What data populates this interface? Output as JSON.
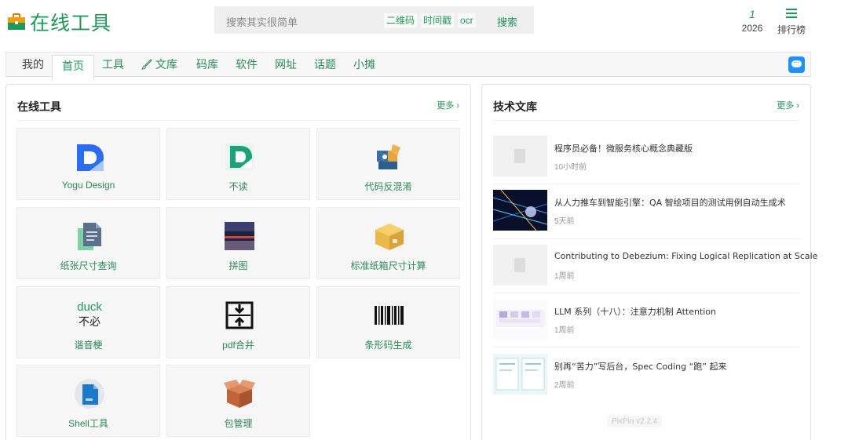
{
  "header": {
    "site_title": "在线工具",
    "search_placeholder": "搜索其实很简单",
    "chips": [
      "二维码",
      "时间戳",
      "ocr"
    ],
    "search_button": "搜索",
    "stat_number": "1",
    "stat_year": "2026",
    "rank_label": "排行榜"
  },
  "nav": {
    "items": [
      "我的",
      "首页",
      "工具",
      "文库",
      "码库",
      "软件",
      "网址",
      "话题",
      "小摊"
    ],
    "active": "首页"
  },
  "tools_panel": {
    "title": "在线工具",
    "more": "更多",
    "tools": [
      {
        "name": "Yogu Design",
        "icon": "yogu-design-icon"
      },
      {
        "name": "不读",
        "icon": "budu-icon"
      },
      {
        "name": "代码反混淆",
        "icon": "code-deobfuscate-icon"
      },
      {
        "name": "纸张尺寸查询",
        "icon": "paper-size-icon"
      },
      {
        "name": "拼图",
        "icon": "puzzle-photo-icon"
      },
      {
        "name": "标准纸箱尺寸计算",
        "icon": "carton-box-icon"
      },
      {
        "name": "谐音梗",
        "icon": "duck-pun-icon",
        "icon_text": [
          "duck",
          "不必"
        ]
      },
      {
        "name": "pdf合并",
        "icon": "pdf-merge-icon"
      },
      {
        "name": "条形码生成",
        "icon": "barcode-icon"
      },
      {
        "name": "Shell工具",
        "icon": "shell-tool-icon"
      },
      {
        "name": "包管理",
        "icon": "package-box-icon"
      }
    ]
  },
  "articles_panel": {
    "title": "技术文库",
    "more": "更多",
    "articles": [
      {
        "title": "程序员必备！微服务核心概念典藏版",
        "time": "10小时前",
        "thumb": "placeholder"
      },
      {
        "title": "从人力推车到智能引擎：QA 智绘项目的测试用例自动生成术",
        "time": "5天前",
        "thumb": "space"
      },
      {
        "title": "Contributing to Debezium: Fixing Logical Replication at Scale",
        "time": "1周前",
        "thumb": "placeholder"
      },
      {
        "title": "LLM 系列（十八）：注意力机制 Attention",
        "time": "1周前",
        "thumb": "attention"
      },
      {
        "title": "别再“苦力”写后台，Spec Coding “跑” 起来",
        "time": "2周前",
        "thumb": "diagram"
      }
    ]
  },
  "watermark": "PixPin v2.2.4",
  "colors": {
    "brand": "#1f9957",
    "chat": "#1e90ff"
  }
}
